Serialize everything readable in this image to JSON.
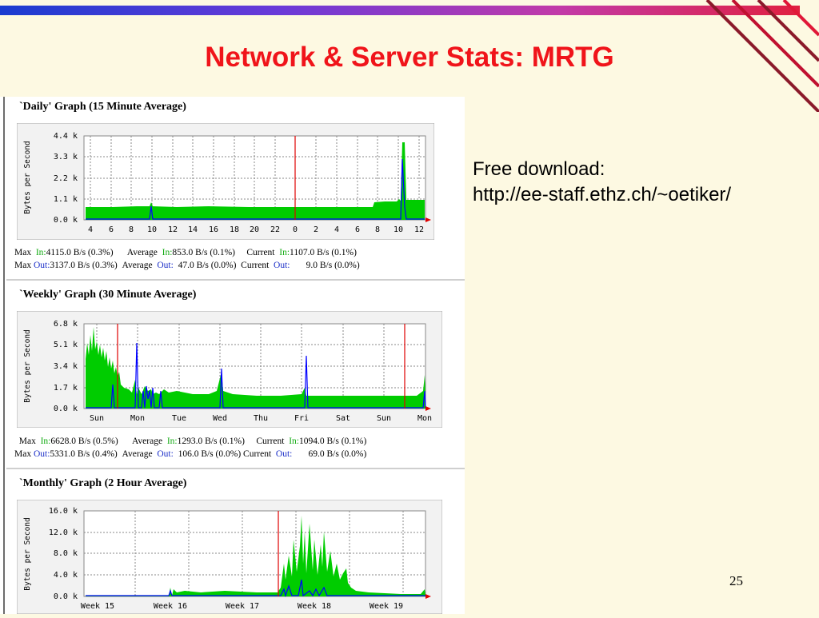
{
  "slide": {
    "title": "Network & Server Stats: MRTG",
    "side_line1": "Free download:",
    "side_line2": "http://ee-staff.ethz.ch/~oetiker/",
    "page_number": "25"
  },
  "colors": {
    "in": "#00cc00",
    "out": "#0000ff",
    "marker": "#e00000",
    "title": "#f0141a"
  },
  "graphs": [
    {
      "title": "`Daily' Graph (15 Minute Average)",
      "ylabel": "Bytes per Second",
      "yticks": [
        "4.4 k",
        "3.3 k",
        "2.2 k",
        "1.1 k",
        "0.0 k"
      ],
      "xticks": [
        "4",
        "6",
        "8",
        "10",
        "12",
        "14",
        "16",
        "18",
        "20",
        "22",
        "0",
        "2",
        "4",
        "6",
        "8",
        "10",
        "12"
      ],
      "stats": {
        "max_label": "Max",
        "avg_label": "Average",
        "cur_label": "Current",
        "in_label": "In:",
        "out_label": "Out:",
        "max_in": "4115.0 B/s (0.3%)",
        "avg_in": "853.0 B/s (0.1%)",
        "cur_in": "1107.0 B/s (0.1%)",
        "max_out": "3137.0 B/s (0.3%)",
        "avg_out": "47.0 B/s (0.0%)",
        "cur_out": "9.0 B/s (0.0%)"
      }
    },
    {
      "title": "`Weekly' Graph (30 Minute Average)",
      "ylabel": "Bytes per Second",
      "yticks": [
        "6.8 k",
        "5.1 k",
        "3.4 k",
        "1.7 k",
        "0.0 k"
      ],
      "xticks": [
        "Sun",
        "Mon",
        "Tue",
        "Wed",
        "Thu",
        "Fri",
        "Sat",
        "Sun",
        "Mon"
      ],
      "stats": {
        "max_label": "Max",
        "avg_label": "Average",
        "cur_label": "Current",
        "in_label": "In:",
        "out_label": "Out:",
        "max_in": "6628.0 B/s (0.5%)",
        "avg_in": "1293.0 B/s (0.1%)",
        "cur_in": "1094.0 B/s (0.1%)",
        "max_out": "5331.0 B/s (0.4%)",
        "avg_out": "106.0 B/s (0.0%)",
        "cur_out": "69.0 B/s (0.0%)"
      }
    },
    {
      "title": "`Monthly' Graph (2 Hour Average)",
      "ylabel": "Bytes per Second",
      "yticks": [
        "16.0 k",
        "12.0 k",
        "8.0 k",
        "4.0 k",
        "0.0 k"
      ],
      "xticks": [
        "Week 15",
        "Week 16",
        "Week 17",
        "Week 18",
        "Week 19"
      ]
    }
  ]
}
